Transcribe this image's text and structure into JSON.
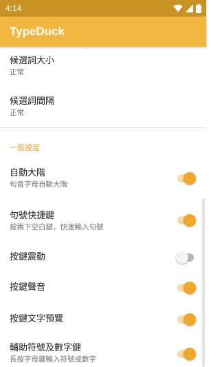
{
  "status_bar": {
    "time": "4:14"
  },
  "app_bar": {
    "title": "TypeDuck"
  },
  "colors": {
    "accent": "#f0b840",
    "status_bar": "#c99224",
    "section_header": "#e8a32a",
    "switch_on": "#f0a72c"
  },
  "settings": {
    "candidate_size": {
      "title": "候選詞大小",
      "summary": "正常"
    },
    "candidate_gap": {
      "title": "候選詞間隔",
      "summary": "正常"
    },
    "general_header": "一般設定",
    "auto_cap": {
      "title": "自動大階",
      "summary": "句首字母自動大階",
      "enabled": true
    },
    "period_shortcut": {
      "title": "句號快捷鍵",
      "summary": "按兩下空白鍵，快速輸入句號",
      "enabled": true
    },
    "key_vibration": {
      "title": "按鍵震動",
      "enabled": false
    },
    "key_sound": {
      "title": "按鍵聲音",
      "enabled": true
    },
    "key_preview": {
      "title": "按鍵文字預覽",
      "enabled": true
    },
    "symbol_keys": {
      "title": "輔助符號及數字鍵",
      "summary": "長按字母鍵輸入符號或數字",
      "enabled": true
    }
  },
  "icons": [
    "wifi-icon",
    "cell-signal-icon",
    "battery-icon"
  ]
}
